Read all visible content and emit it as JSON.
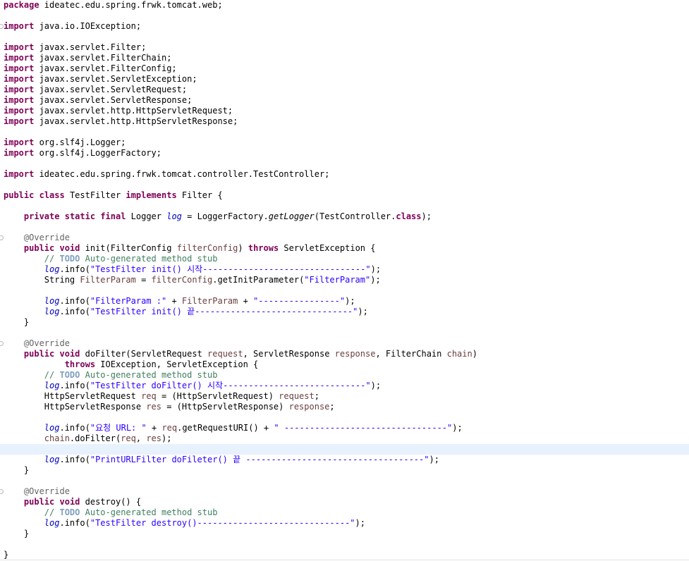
{
  "editor": {
    "current_line": 42,
    "lines": [
      {
        "folded": false,
        "tokens": [
          {
            "t": "package",
            "c": "kw"
          },
          {
            "t": " ideatec.edu.spring.frwk.tomcat.web;"
          }
        ]
      },
      {
        "folded": false,
        "tokens": []
      },
      {
        "folded": true,
        "tokens": [
          {
            "t": "import",
            "c": "kw"
          },
          {
            "t": " java.io.IOException;"
          }
        ]
      },
      {
        "folded": false,
        "tokens": []
      },
      {
        "folded": false,
        "tokens": [
          {
            "t": "import",
            "c": "kw"
          },
          {
            "t": " javax.servlet.Filter;"
          }
        ]
      },
      {
        "folded": false,
        "tokens": [
          {
            "t": "import",
            "c": "kw"
          },
          {
            "t": " javax.servlet.FilterChain;"
          }
        ]
      },
      {
        "folded": false,
        "tokens": [
          {
            "t": "import",
            "c": "kw"
          },
          {
            "t": " javax.servlet.FilterConfig;"
          }
        ]
      },
      {
        "folded": false,
        "tokens": [
          {
            "t": "import",
            "c": "kw"
          },
          {
            "t": " javax.servlet.ServletException;"
          }
        ]
      },
      {
        "folded": false,
        "tokens": [
          {
            "t": "import",
            "c": "kw"
          },
          {
            "t": " javax.servlet.ServletRequest;"
          }
        ]
      },
      {
        "folded": false,
        "tokens": [
          {
            "t": "import",
            "c": "kw"
          },
          {
            "t": " javax.servlet.ServletResponse;"
          }
        ]
      },
      {
        "folded": false,
        "tokens": [
          {
            "t": "import",
            "c": "kw"
          },
          {
            "t": " javax.servlet.http.HttpServletRequest;"
          }
        ]
      },
      {
        "folded": false,
        "tokens": [
          {
            "t": "import",
            "c": "kw"
          },
          {
            "t": " javax.servlet.http.HttpServletResponse;"
          }
        ]
      },
      {
        "folded": false,
        "tokens": []
      },
      {
        "folded": false,
        "tokens": [
          {
            "t": "import",
            "c": "kw"
          },
          {
            "t": " org.slf4j.Logger;"
          }
        ]
      },
      {
        "folded": false,
        "tokens": [
          {
            "t": "import",
            "c": "kw"
          },
          {
            "t": " org.slf4j.LoggerFactory;"
          }
        ]
      },
      {
        "folded": false,
        "tokens": []
      },
      {
        "folded": false,
        "tokens": [
          {
            "t": "import",
            "c": "kw"
          },
          {
            "t": " ideatec.edu.spring.frwk.tomcat.controller.TestController;"
          }
        ]
      },
      {
        "folded": false,
        "tokens": []
      },
      {
        "folded": false,
        "tokens": [
          {
            "t": "public",
            "c": "kw"
          },
          {
            "t": " "
          },
          {
            "t": "class",
            "c": "kw"
          },
          {
            "t": " TestFilter "
          },
          {
            "t": "implements",
            "c": "kw"
          },
          {
            "t": " Filter {"
          }
        ]
      },
      {
        "folded": false,
        "tokens": []
      },
      {
        "folded": false,
        "tokens": [
          {
            "t": "    "
          },
          {
            "t": "private",
            "c": "kw"
          },
          {
            "t": " "
          },
          {
            "t": "static",
            "c": "kw"
          },
          {
            "t": " "
          },
          {
            "t": "final",
            "c": "kw"
          },
          {
            "t": " Logger "
          },
          {
            "t": "log",
            "c": "fld"
          },
          {
            "t": " = LoggerFactory."
          },
          {
            "t": "getLogger",
            "c": "mth"
          },
          {
            "t": "(TestController."
          },
          {
            "t": "class",
            "c": "kw"
          },
          {
            "t": ");"
          }
        ]
      },
      {
        "folded": false,
        "tokens": []
      },
      {
        "folded": true,
        "tokens": [
          {
            "t": "    "
          },
          {
            "t": "@Override",
            "c": "ann"
          }
        ]
      },
      {
        "folded": false,
        "tokens": [
          {
            "t": "    "
          },
          {
            "t": "public",
            "c": "kw"
          },
          {
            "t": " "
          },
          {
            "t": "void",
            "c": "kw"
          },
          {
            "t": " init(FilterConfig "
          },
          {
            "t": "filterConfig",
            "c": "param"
          },
          {
            "t": ") "
          },
          {
            "t": "throws",
            "c": "kw"
          },
          {
            "t": " ServletException {"
          }
        ]
      },
      {
        "folded": false,
        "tokens": [
          {
            "t": "        "
          },
          {
            "t": "// ",
            "c": "cm"
          },
          {
            "t": "TODO",
            "c": "todo"
          },
          {
            "t": " Auto-generated method stub",
            "c": "cm"
          }
        ]
      },
      {
        "folded": false,
        "tokens": [
          {
            "t": "        "
          },
          {
            "t": "log",
            "c": "fld"
          },
          {
            "t": ".info("
          },
          {
            "t": "\"TestFilter init() 시작--------------------------------\"",
            "c": "str"
          },
          {
            "t": ");"
          }
        ]
      },
      {
        "folded": false,
        "tokens": [
          {
            "t": "        String "
          },
          {
            "t": "FilterParam",
            "c": "param"
          },
          {
            "t": " = "
          },
          {
            "t": "filterConfig",
            "c": "param"
          },
          {
            "t": ".getInitParameter("
          },
          {
            "t": "\"FilterParam\"",
            "c": "str"
          },
          {
            "t": ");"
          }
        ]
      },
      {
        "folded": false,
        "tokens": []
      },
      {
        "folded": false,
        "tokens": [
          {
            "t": "        "
          },
          {
            "t": "log",
            "c": "fld"
          },
          {
            "t": ".info("
          },
          {
            "t": "\"FilterParam :\"",
            "c": "str"
          },
          {
            "t": " + "
          },
          {
            "t": "FilterParam",
            "c": "param"
          },
          {
            "t": " + "
          },
          {
            "t": "\"----------------\"",
            "c": "str"
          },
          {
            "t": ");"
          }
        ]
      },
      {
        "folded": false,
        "tokens": [
          {
            "t": "        "
          },
          {
            "t": "log",
            "c": "fld"
          },
          {
            "t": ".info("
          },
          {
            "t": "\"TestFilter init() 끝-------------------------------\"",
            "c": "str"
          },
          {
            "t": ");"
          }
        ]
      },
      {
        "folded": false,
        "tokens": [
          {
            "t": "    }"
          }
        ]
      },
      {
        "folded": false,
        "tokens": []
      },
      {
        "folded": true,
        "tokens": [
          {
            "t": "    "
          },
          {
            "t": "@Override",
            "c": "ann"
          }
        ]
      },
      {
        "folded": false,
        "tokens": [
          {
            "t": "    "
          },
          {
            "t": "public",
            "c": "kw"
          },
          {
            "t": " "
          },
          {
            "t": "void",
            "c": "kw"
          },
          {
            "t": " doFilter(ServletRequest "
          },
          {
            "t": "request",
            "c": "param"
          },
          {
            "t": ", ServletResponse "
          },
          {
            "t": "response",
            "c": "param"
          },
          {
            "t": ", FilterChain "
          },
          {
            "t": "chain",
            "c": "param"
          },
          {
            "t": ")"
          }
        ]
      },
      {
        "folded": false,
        "tokens": [
          {
            "t": "            "
          },
          {
            "t": "throws",
            "c": "kw"
          },
          {
            "t": " IOException, ServletException {"
          }
        ]
      },
      {
        "folded": false,
        "tokens": [
          {
            "t": "        "
          },
          {
            "t": "// ",
            "c": "cm"
          },
          {
            "t": "TODO",
            "c": "todo"
          },
          {
            "t": " Auto-generated method stub",
            "c": "cm"
          }
        ]
      },
      {
        "folded": false,
        "tokens": [
          {
            "t": "        "
          },
          {
            "t": "log",
            "c": "fld"
          },
          {
            "t": ".info("
          },
          {
            "t": "\"TestFilter doFilter() 시작----------------------------\"",
            "c": "str"
          },
          {
            "t": ");"
          }
        ]
      },
      {
        "folded": false,
        "tokens": [
          {
            "t": "        HttpServletRequest "
          },
          {
            "t": "req",
            "c": "param"
          },
          {
            "t": " = (HttpServletRequest) "
          },
          {
            "t": "request",
            "c": "param"
          },
          {
            "t": ";"
          }
        ]
      },
      {
        "folded": false,
        "tokens": [
          {
            "t": "        HttpServletResponse "
          },
          {
            "t": "res",
            "c": "param"
          },
          {
            "t": " = (HttpServletResponse) "
          },
          {
            "t": "response",
            "c": "param"
          },
          {
            "t": ";"
          }
        ]
      },
      {
        "folded": false,
        "tokens": []
      },
      {
        "folded": false,
        "tokens": [
          {
            "t": "        "
          },
          {
            "t": "log",
            "c": "fld"
          },
          {
            "t": ".info("
          },
          {
            "t": "\"요청 URL: \"",
            "c": "str"
          },
          {
            "t": " + "
          },
          {
            "t": "req",
            "c": "param"
          },
          {
            "t": ".getRequestURI() + "
          },
          {
            "t": "\" --------------------------------\"",
            "c": "str"
          },
          {
            "t": ");"
          }
        ]
      },
      {
        "folded": false,
        "tokens": [
          {
            "t": "        "
          },
          {
            "t": "chain",
            "c": "param"
          },
          {
            "t": ".doFilter("
          },
          {
            "t": "req",
            "c": "param"
          },
          {
            "t": ", "
          },
          {
            "t": "res",
            "c": "param"
          },
          {
            "t": ");"
          }
        ]
      },
      {
        "folded": false,
        "tokens": []
      },
      {
        "folded": false,
        "tokens": [
          {
            "t": "        "
          },
          {
            "t": "log",
            "c": "fld"
          },
          {
            "t": ".info("
          },
          {
            "t": "\"PrintURLFilter doFileter() 끝 -----------------------------------\"",
            "c": "str"
          },
          {
            "t": ");"
          }
        ]
      },
      {
        "folded": false,
        "tokens": [
          {
            "t": "    }"
          }
        ]
      },
      {
        "folded": false,
        "tokens": []
      },
      {
        "folded": true,
        "tokens": [
          {
            "t": "    "
          },
          {
            "t": "@Override",
            "c": "ann"
          }
        ]
      },
      {
        "folded": false,
        "tokens": [
          {
            "t": "    "
          },
          {
            "t": "public",
            "c": "kw"
          },
          {
            "t": " "
          },
          {
            "t": "void",
            "c": "kw"
          },
          {
            "t": " destroy() {"
          }
        ]
      },
      {
        "folded": false,
        "tokens": [
          {
            "t": "        "
          },
          {
            "t": "// ",
            "c": "cm"
          },
          {
            "t": "TODO",
            "c": "todo"
          },
          {
            "t": " Auto-generated method stub",
            "c": "cm"
          }
        ]
      },
      {
        "folded": false,
        "tokens": [
          {
            "t": "        "
          },
          {
            "t": "log",
            "c": "fld"
          },
          {
            "t": ".info("
          },
          {
            "t": "\"TestFilter destroy()------------------------------\"",
            "c": "str"
          },
          {
            "t": ");"
          }
        ]
      },
      {
        "folded": false,
        "tokens": [
          {
            "t": "    }"
          }
        ]
      },
      {
        "folded": false,
        "tokens": []
      },
      {
        "folded": false,
        "tokens": [
          {
            "t": "}"
          }
        ]
      }
    ]
  }
}
